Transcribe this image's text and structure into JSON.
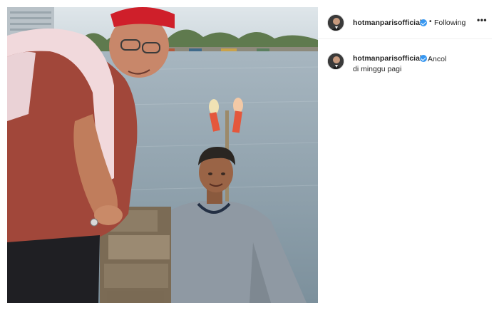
{
  "post": {
    "author": {
      "username": "hotmanparisofficial",
      "verified": true,
      "avatar_icon": "profile-avatar"
    },
    "header": {
      "separator": "•",
      "follow_status": "Following",
      "more_label": "•••"
    },
    "caption": {
      "text": "Ancol di minggu pagi"
    },
    "media": {
      "type": "photo",
      "description_icon": "post-photo"
    },
    "colors": {
      "verified_badge": "#3897f0",
      "text": "#262626",
      "divider": "#efefef"
    }
  }
}
